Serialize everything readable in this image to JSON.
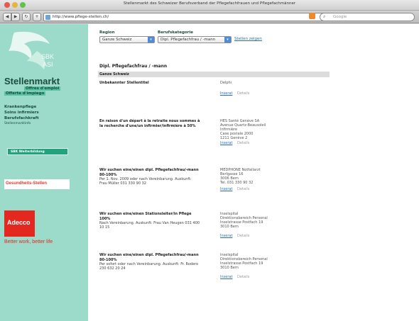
{
  "window": {
    "title": "Stellenmarkt des Schweizer Berufsverband der Pflegefachfrauen und Pflegefachmänner"
  },
  "toolbar": {
    "back_icon": "back-arrow-icon",
    "forward_icon": "forward-arrow-icon",
    "reload_icon": "reload-icon",
    "home_icon": "home-icon",
    "url": "http://www.pflege-stellen.ch/",
    "search_placeholder": "Google"
  },
  "sidebar": {
    "logo_text": "SBK",
    "logo_sub": "ASI",
    "title": "Stellenmarkt",
    "offres_line1": "Offres d'emploi",
    "offres_line2": "Offerte d'impiego",
    "links": [
      "Krankenpflege",
      "Soins infirmiers",
      "Berufsfachkraft"
    ],
    "small_link": "Stellenmarktinfo",
    "sbk_banner": "SBK Weiterbildung",
    "ad_banner": "Gesundheits-Stellen",
    "adecco": "Adecco",
    "adecco_slogan": "Better work, better life"
  },
  "filters": {
    "region_label": "Region",
    "category_label": "Berufskategorie",
    "region_value": "Ganze Schweiz",
    "category_value": "Dipl. Pflegefachfrau / -mann",
    "show_link": "Stellen zeigen"
  },
  "main": {
    "section_title": "Dipl. Pflegefachfrau / -mann",
    "region_bar": "Ganze Schweiz"
  },
  "jobs": [
    {
      "title": "Unbekannter Stellentitel",
      "desc": "",
      "employer": "Delphi",
      "detail_link": "Inserat",
      "extra_link": "Details"
    },
    {
      "title": "En raison d'un départ à la retraite nous sommes à la recherche d'une/un infirmier/infirmière à 50%",
      "desc": "",
      "employer": "HES Santé Genève SA\nAvenue Quartz-Beausoleil\nInfirmière\nCase postale 2000\n1211 Genève 2",
      "detail_link": "Inserat",
      "extra_link": "Details"
    },
    {
      "title": "Wir suchen eine/einen dipl. Pflegefachfrau/-mann 80-100%",
      "desc": "Per 1. Nov. 2009 oder nach Vereinbarung. Auskunft: Frau Müller 031 330 90 32",
      "employer": "MEDPHONE Notfallarzt\nBerlgasse 16\n3006 Bern\nTel. 031 330 90 32",
      "detail_link": "Inserat",
      "extra_link": "Details"
    },
    {
      "title": "Wir suchen eine/einen Stationsleiter/in Pflege 100%",
      "desc": "Nach Vereinbarung. Auskunft: Frau Van Heugen 031 400 10 15",
      "employer": "Inselspital\nDirektionsbereich Personal\nInselstrasse Postfach 19\n3010 Bern",
      "detail_link": "Inserat",
      "extra_link": "Details"
    },
    {
      "title": "Wir suchen eine/einen dipl. Pflegefachfrau/-mann 80-100%",
      "desc": "Per sofort oder nach Vereinbarung. Auskunft: Fr. Rodero 230 632 20 24",
      "employer": "Inselspital\nDirektionsbereich Personal\nInselstrasse Postfach 19\n3010 Bern",
      "detail_link": "Inserat",
      "extra_link": "Details"
    }
  ]
}
